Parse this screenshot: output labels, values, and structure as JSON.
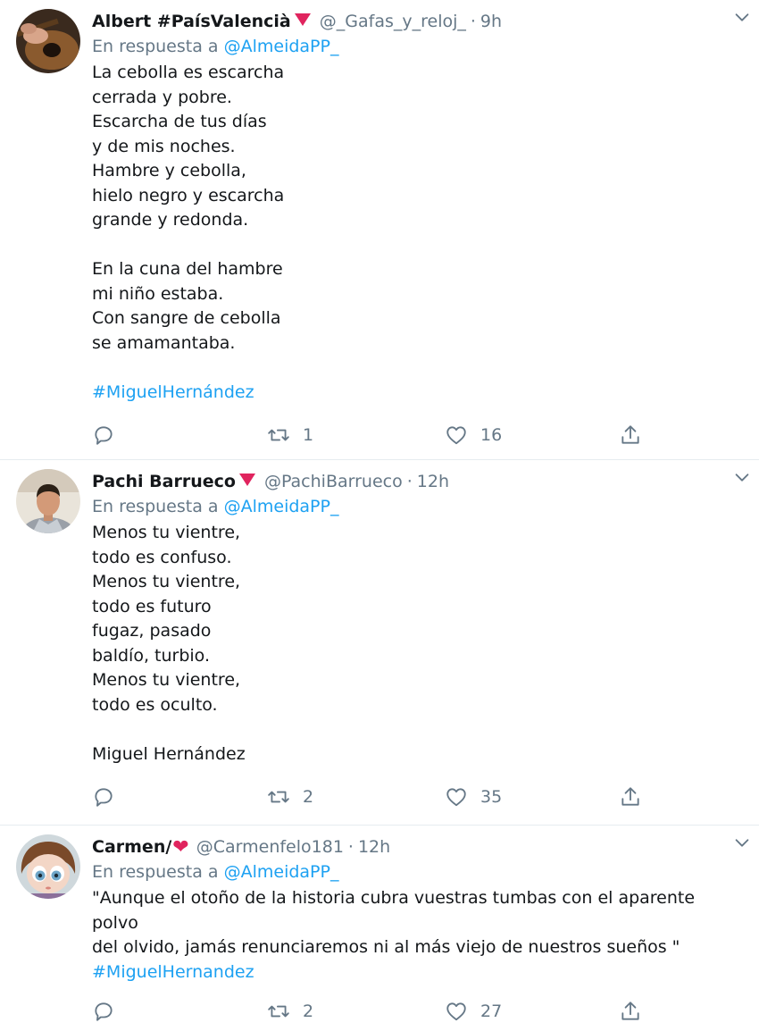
{
  "tweets": [
    {
      "name": "Albert #PaísValencià",
      "badge": "red-triangle",
      "handle": "@_Gafas_y_reloj_",
      "separator": "·",
      "time": "9h",
      "reply_prefix": "En respuesta a",
      "reply_mention": "@AlmeidaPP_",
      "lines": [
        "La cebolla es escarcha",
        "cerrada y pobre.",
        "Escarcha de tus días",
        "y de mis noches.",
        "Hambre y cebolla,",
        "hielo negro y escarcha",
        "grande y redonda.",
        "",
        "En la cuna del hambre",
        "mi niño estaba.",
        "Con sangre de cebolla",
        "se amamantaba.",
        ""
      ],
      "hashtag": "#MiguelHernández",
      "retweets": "1",
      "likes": "16"
    },
    {
      "name": "Pachi Barrueco",
      "badge": "red-triangle",
      "handle": "@PachiBarrueco",
      "separator": "·",
      "time": "12h",
      "reply_prefix": "En respuesta a",
      "reply_mention": "@AlmeidaPP_",
      "lines": [
        "Menos tu vientre,",
        "todo es confuso.",
        "Menos tu vientre,",
        "todo es futuro",
        "fugaz, pasado",
        "baldío, turbio.",
        "Menos tu vientre,",
        "todo es oculto.",
        "",
        "Miguel Hernández"
      ],
      "retweets": "2",
      "likes": "35"
    },
    {
      "name": "Carmen/",
      "badge": "red-heart",
      "heart_glyph": "❤",
      "handle": "@Carmenfelo181",
      "separator": "·",
      "time": "12h",
      "reply_prefix": "En respuesta a",
      "reply_mention": "@AlmeidaPP_",
      "lines": [
        "\"Aunque el otoño de la historia cubra vuestras tumbas con el aparente polvo",
        "del olvido, jamás renunciaremos ni al más viejo de nuestros sueños \""
      ],
      "hashtag": "#MiguelHernandez",
      "retweets": "2",
      "likes": "27"
    }
  ],
  "icons": {
    "reply": "reply-icon",
    "retweet": "retweet-icon",
    "like": "heart-icon",
    "share": "share-icon",
    "menu": "chevron-down-icon"
  },
  "colors": {
    "link": "#1da1f2",
    "muted": "#657786",
    "text": "#14171a",
    "accent": "#e0245e",
    "divider": "#e6ecf0"
  }
}
